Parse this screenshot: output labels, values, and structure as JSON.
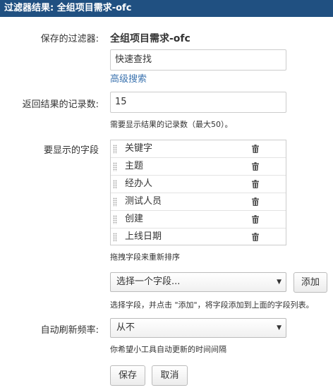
{
  "window": {
    "title": "过滤器结果: 全组项目需求-ofc"
  },
  "form": {
    "saved_filter_label": "保存的过滤器:",
    "saved_filter_value": "全组项目需求-ofc",
    "quick_search_value": "快速查找",
    "advanced_search_link": "高级搜索",
    "record_count_label": "返回结果的记录数:",
    "record_count_value": "15",
    "record_count_hint": "需要显示结果的记录数（最大50）。",
    "fields_label": "要显示的字段",
    "fields": [
      {
        "name": "关键字",
        "icon": "trash-icon"
      },
      {
        "name": "主题",
        "icon": "trash-icon"
      },
      {
        "name": "经办人",
        "icon": "trash-icon"
      },
      {
        "name": "测试人员",
        "icon": "trash-icon"
      },
      {
        "name": "创建",
        "icon": "trash-icon"
      },
      {
        "name": "上线日期",
        "icon": "trash-icon"
      }
    ],
    "fields_hint": "拖拽字段来重新排序",
    "field_select_value": "选择一个字段...",
    "add_button": "添加",
    "add_hint": "选择字段，并点击 \"添加\"，将字段添加到上面的字段列表。",
    "refresh_label": "自动刷新频率:",
    "refresh_value": "从不",
    "refresh_hint": "你希望小工具自动更新的时间间隔",
    "save_button": "保存",
    "cancel_button": "取消"
  },
  "colors": {
    "titlebar": "#205081",
    "link": "#3b73af"
  }
}
